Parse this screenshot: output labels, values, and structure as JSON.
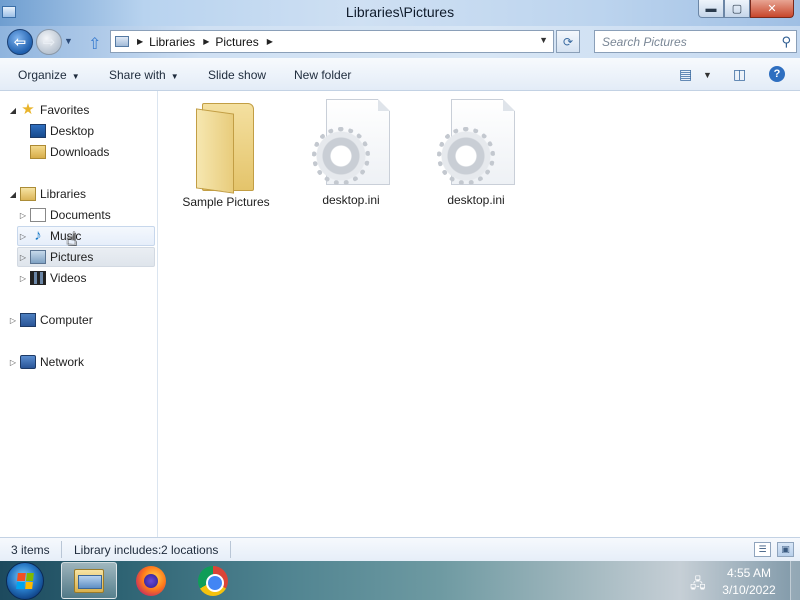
{
  "window": {
    "title": "Libraries\\Pictures",
    "controls": {
      "minimize": "▬",
      "maximize": "▢",
      "close": "✕"
    }
  },
  "address_bar": {
    "crumbs": [
      "Libraries",
      "Pictures"
    ],
    "search_placeholder": "Search Pictures"
  },
  "toolbar": {
    "organize": "Organize",
    "share_with": "Share with",
    "slide_show": "Slide show",
    "new_folder": "New folder"
  },
  "nav": {
    "favorites": "Favorites",
    "desktop": "Desktop",
    "downloads": "Downloads",
    "libraries": "Libraries",
    "documents": "Documents",
    "music": "Music",
    "pictures": "Pictures",
    "videos": "Videos",
    "computer": "Computer",
    "network": "Network"
  },
  "files": [
    {
      "name": "Sample Pictures",
      "icon": "folder-icon"
    },
    {
      "name": "desktop.ini",
      "icon": "config-file-icon"
    },
    {
      "name": "desktop.ini",
      "icon": "config-file-icon"
    }
  ],
  "status": {
    "item_count": "3 items",
    "library_info": "Library includes:",
    "locations_link": "2 locations"
  },
  "taskbar": {
    "apps": [
      "Windows Explorer",
      "Firefox",
      "Google Chrome"
    ],
    "time": "4:55 AM",
    "date": "3/10/2022"
  },
  "colors": {
    "accent": "#2677c4",
    "selection": "#dfe5ec",
    "hover": "#e6eefa"
  }
}
